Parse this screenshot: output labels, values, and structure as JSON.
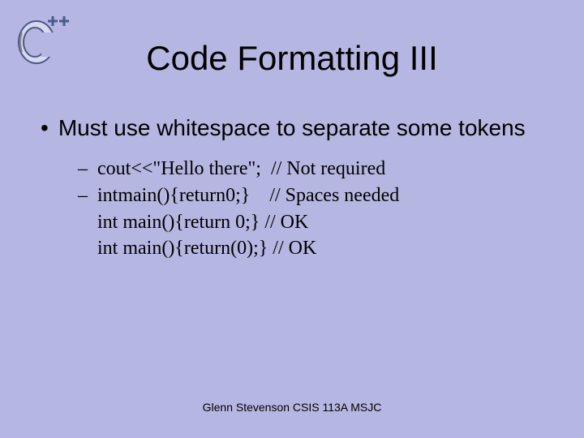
{
  "title": "Code Formatting III",
  "main_bullet": "Must use whitespace to separate some tokens",
  "sub_items": [
    {
      "dash": "–",
      "line": "cout<<\"Hello there\";  // Not required"
    },
    {
      "dash": "–",
      "line": "intmain(){return0;}    // Spaces needed"
    }
  ],
  "continues": [
    "int main(){return 0;} // OK",
    "int main(){return(0);} // OK"
  ],
  "footer": "Glenn Stevenson CSIS 113A MSJC"
}
